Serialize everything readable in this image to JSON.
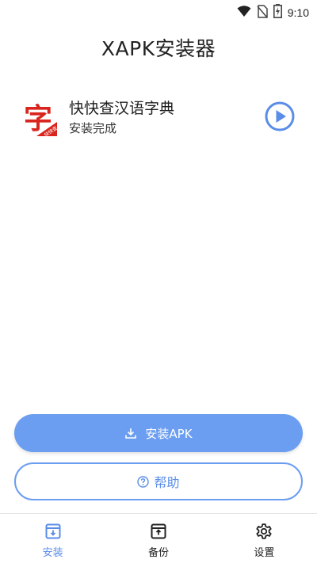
{
  "status_bar": {
    "time": "9:10",
    "icons": [
      "wifi-icon",
      "no-sim-icon",
      "battery-charging-icon"
    ]
  },
  "header": {
    "title": "XAPK安装器"
  },
  "apps": [
    {
      "name": "快快查汉语字典",
      "status": "安装完成",
      "icon": "dictionary-app-icon",
      "icon_glyph": "字",
      "icon_badge": "快快查"
    }
  ],
  "actions": {
    "install_label": "安装APK",
    "help_label": "帮助"
  },
  "bottom_nav": [
    {
      "label": "安装",
      "icon": "install-tab-icon",
      "active": true
    },
    {
      "label": "备份",
      "icon": "backup-tab-icon",
      "active": false
    },
    {
      "label": "设置",
      "icon": "settings-tab-icon",
      "active": false
    }
  ],
  "colors": {
    "accent": "#6b9df0",
    "accent_text": "#5a8de8",
    "icon_red": "#d9251d"
  }
}
